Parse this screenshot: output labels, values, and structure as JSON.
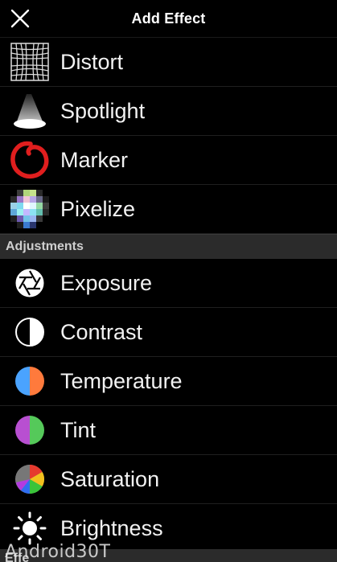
{
  "header": {
    "title": "Add Effect",
    "close_icon": "close-icon"
  },
  "effects": [
    {
      "label": "Distort",
      "icon": "distort-grid-icon"
    },
    {
      "label": "Spotlight",
      "icon": "spotlight-icon"
    },
    {
      "label": "Marker",
      "icon": "marker-circle-icon"
    },
    {
      "label": "Pixelize",
      "icon": "pixelize-icon"
    }
  ],
  "adjustments_header": "Adjustments",
  "adjustments": [
    {
      "label": "Exposure",
      "icon": "aperture-icon"
    },
    {
      "label": "Contrast",
      "icon": "contrast-icon"
    },
    {
      "label": "Temperature",
      "icon": "temperature-icon"
    },
    {
      "label": "Tint",
      "icon": "tint-icon"
    },
    {
      "label": "Saturation",
      "icon": "saturation-icon"
    },
    {
      "label": "Brightness",
      "icon": "brightness-icon"
    }
  ],
  "bottom_section_partial": "Effe",
  "watermark": "Android30T",
  "colors": {
    "marker_red": "#e01e1e",
    "temp_blue": "#4aa3ff",
    "temp_orange": "#ff7a3c",
    "tint_purple": "#b84fd1",
    "tint_green": "#55c95a"
  }
}
